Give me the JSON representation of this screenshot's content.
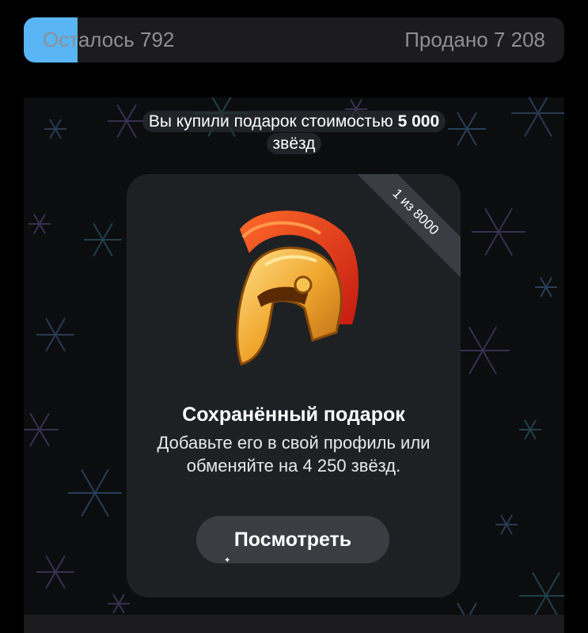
{
  "stock": {
    "remaining_label": "Осталось 792",
    "sold_label": "Продано 7 208",
    "sold_fraction": 0.9,
    "accent": "#5ab5f5"
  },
  "service": {
    "text_prefix": "Вы купили подарок стоимостью ",
    "text_amount": "5 000",
    "text_suffix": "звёзд"
  },
  "gift": {
    "ribbon": "1 из 8000",
    "icon": "spartan-helmet-icon",
    "title": "Сохранённый подарок",
    "description": "Добавьте его в свой профиль или обменяйте на 4 250 звёзд.",
    "button": "Посмотреть"
  }
}
